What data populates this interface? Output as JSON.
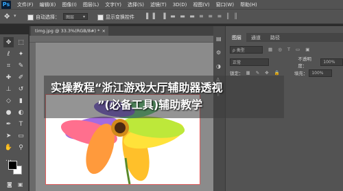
{
  "app": {
    "logo": "Ps"
  },
  "menu": [
    "文件(F)",
    "编辑(E)",
    "图像(I)",
    "图层(L)",
    "文字(Y)",
    "选择(S)",
    "滤镜(T)",
    "3D(D)",
    "视图(V)",
    "窗口(W)",
    "帮助(H)"
  ],
  "options": {
    "auto_select_label": "自动选择：",
    "auto_select_value": "图层",
    "show_transform_label": "显示变换控件"
  },
  "document": {
    "tab_label": "timg.jpg @ 33.3%(RGB/8#) *",
    "close": "×"
  },
  "layers_panel": {
    "tabs": [
      "图层",
      "通道",
      "路径"
    ],
    "kind_label": "ρ 类型",
    "blend_mode": "正常",
    "opacity_label": "不透明度：",
    "opacity_value": "100%",
    "lock_label": "锁定：",
    "fill_label": "填充：",
    "fill_value": "100%"
  },
  "overlay": {
    "line1": "实操教程“浙江游戏大厅辅助器透视",
    "line2": "”(必备工具)辅助教学"
  },
  "colors": {
    "ui_dark": "#535353",
    "canvas_bg": "#8b8b8b",
    "accent": "#31a8ff"
  }
}
